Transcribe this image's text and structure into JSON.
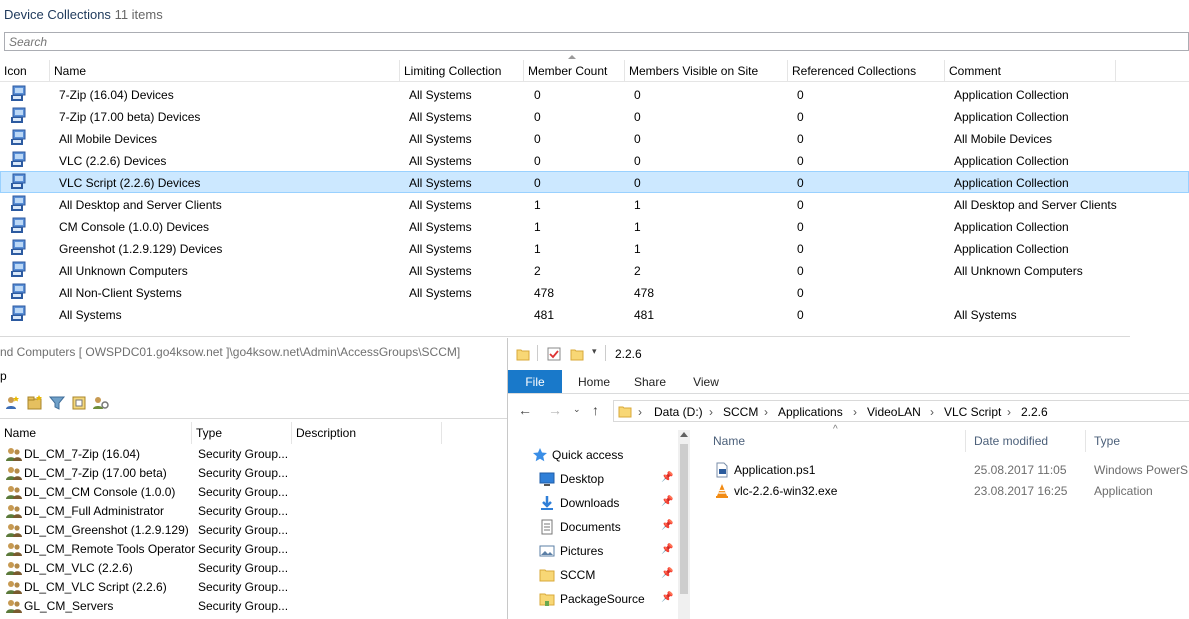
{
  "sccm": {
    "title": "Device Collections",
    "count": "11 items",
    "search_placeholder": "Search",
    "columns": [
      "Icon",
      "Name",
      "Limiting Collection",
      "Member Count",
      "Members Visible on Site",
      "Referenced Collections",
      "Comment"
    ],
    "rows": [
      {
        "name": "7-Zip (16.04) Devices",
        "limiting": "All Systems",
        "member_count": "0",
        "visible": "0",
        "referenced": "0",
        "comment": "Application Collection",
        "selected": false
      },
      {
        "name": "7-Zip (17.00 beta) Devices",
        "limiting": "All Systems",
        "member_count": "0",
        "visible": "0",
        "referenced": "0",
        "comment": "Application Collection",
        "selected": false
      },
      {
        "name": "All Mobile Devices",
        "limiting": "All Systems",
        "member_count": "0",
        "visible": "0",
        "referenced": "0",
        "comment": "All Mobile Devices",
        "selected": false
      },
      {
        "name": "VLC (2.2.6) Devices",
        "limiting": "All Systems",
        "member_count": "0",
        "visible": "0",
        "referenced": "0",
        "comment": "Application Collection",
        "selected": false
      },
      {
        "name": "VLC Script (2.2.6) Devices",
        "limiting": "All Systems",
        "member_count": "0",
        "visible": "0",
        "referenced": "0",
        "comment": "Application Collection",
        "selected": true
      },
      {
        "name": "All Desktop and Server Clients",
        "limiting": "All Systems",
        "member_count": "1",
        "visible": "1",
        "referenced": "0",
        "comment": "All Desktop and Server Clients",
        "selected": false
      },
      {
        "name": "CM Console (1.0.0) Devices",
        "limiting": "All Systems",
        "member_count": "1",
        "visible": "1",
        "referenced": "0",
        "comment": "Application Collection",
        "selected": false
      },
      {
        "name": "Greenshot (1.2.9.129) Devices",
        "limiting": "All Systems",
        "member_count": "1",
        "visible": "1",
        "referenced": "0",
        "comment": "Application Collection",
        "selected": false
      },
      {
        "name": "All Unknown Computers",
        "limiting": "All Systems",
        "member_count": "2",
        "visible": "2",
        "referenced": "0",
        "comment": "All Unknown Computers",
        "selected": false
      },
      {
        "name": "All Non-Client Systems",
        "limiting": "All Systems",
        "member_count": "478",
        "visible": "478",
        "referenced": "0",
        "comment": "",
        "selected": false
      },
      {
        "name": "All Systems",
        "limiting": "",
        "member_count": "481",
        "visible": "481",
        "referenced": "0",
        "comment": "All Systems",
        "selected": false
      }
    ]
  },
  "ad": {
    "path": "nd Computers [ OWSPDC01.go4ksow.net ]\\go4ksow.net\\Admin\\AccessGroups\\SCCM]",
    "menu_fragment": "p",
    "toolbar_icons": [
      "new-user-icon",
      "new-group-icon",
      "filter-icon",
      "add-to-group-icon",
      "delegate-icon"
    ],
    "columns": [
      "Name",
      "Type",
      "Description"
    ],
    "rows": [
      {
        "name": "DL_CM_7-Zip (16.04)",
        "type": "Security Group...",
        "description": ""
      },
      {
        "name": "DL_CM_7-Zip (17.00 beta)",
        "type": "Security Group...",
        "description": ""
      },
      {
        "name": "DL_CM_CM Console (1.0.0)",
        "type": "Security Group...",
        "description": ""
      },
      {
        "name": "DL_CM_Full Administrator",
        "type": "Security Group...",
        "description": ""
      },
      {
        "name": "DL_CM_Greenshot (1.2.9.129)",
        "type": "Security Group...",
        "description": ""
      },
      {
        "name": "DL_CM_Remote Tools Operator",
        "type": "Security Group...",
        "description": ""
      },
      {
        "name": "DL_CM_VLC (2.2.6)",
        "type": "Security Group...",
        "description": ""
      },
      {
        "name": "DL_CM_VLC Script (2.2.6)",
        "type": "Security Group...",
        "description": ""
      },
      {
        "name": "GL_CM_Servers",
        "type": "Security Group...",
        "description": ""
      }
    ]
  },
  "explorer": {
    "title": "2.2.6",
    "ribbon_tabs": [
      "File",
      "Home",
      "Share",
      "View"
    ],
    "breadcrumbs": [
      "Data (D:)",
      "SCCM",
      "Applications",
      "VideoLAN",
      "VLC Script",
      "2.2.6"
    ],
    "nav_items": [
      {
        "label": "Quick access",
        "icon": "star-icon",
        "pinned": false
      },
      {
        "label": "Desktop",
        "icon": "desktop-icon",
        "pinned": true
      },
      {
        "label": "Downloads",
        "icon": "download-icon",
        "pinned": true
      },
      {
        "label": "Documents",
        "icon": "documents-icon",
        "pinned": true
      },
      {
        "label": "Pictures",
        "icon": "pictures-icon",
        "pinned": true
      },
      {
        "label": "SCCM",
        "icon": "folder-icon",
        "pinned": true
      },
      {
        "label": "PackageSource",
        "icon": "folder-pinned-icon",
        "pinned": true
      }
    ],
    "columns": [
      "Name",
      "Date modified",
      "Type"
    ],
    "files": [
      {
        "name": "Application.ps1",
        "date": "25.08.2017 11:05",
        "type": "Windows PowerS...",
        "icon": "powershell-file-icon"
      },
      {
        "name": "vlc-2.2.6-win32.exe",
        "date": "23.08.2017 16:25",
        "type": "Application",
        "icon": "vlc-cone-icon"
      }
    ]
  },
  "colors": {
    "selection_bg": "#cce8ff",
    "file_tab_bg": "#1979ca",
    "title_text": "#1e395b"
  }
}
